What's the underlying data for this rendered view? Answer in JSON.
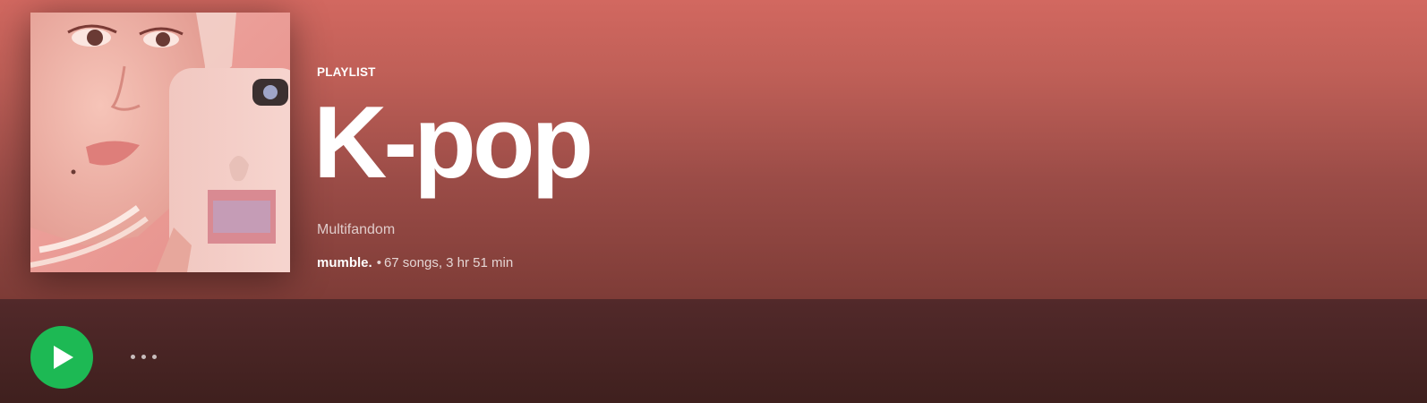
{
  "playlist": {
    "type_label": "PLAYLIST",
    "title": "K-pop",
    "description": "Multifandom",
    "owner": "mumble.",
    "separator": "•",
    "stats": "67 songs, 3 hr 51 min"
  },
  "colors": {
    "header_top": "#d26860",
    "header_bottom": "#7e3c37",
    "actionbar": "#3f201e",
    "play_button": "#1db954"
  },
  "icons": {
    "play": "play-triangle",
    "more": "horizontal-ellipsis"
  }
}
